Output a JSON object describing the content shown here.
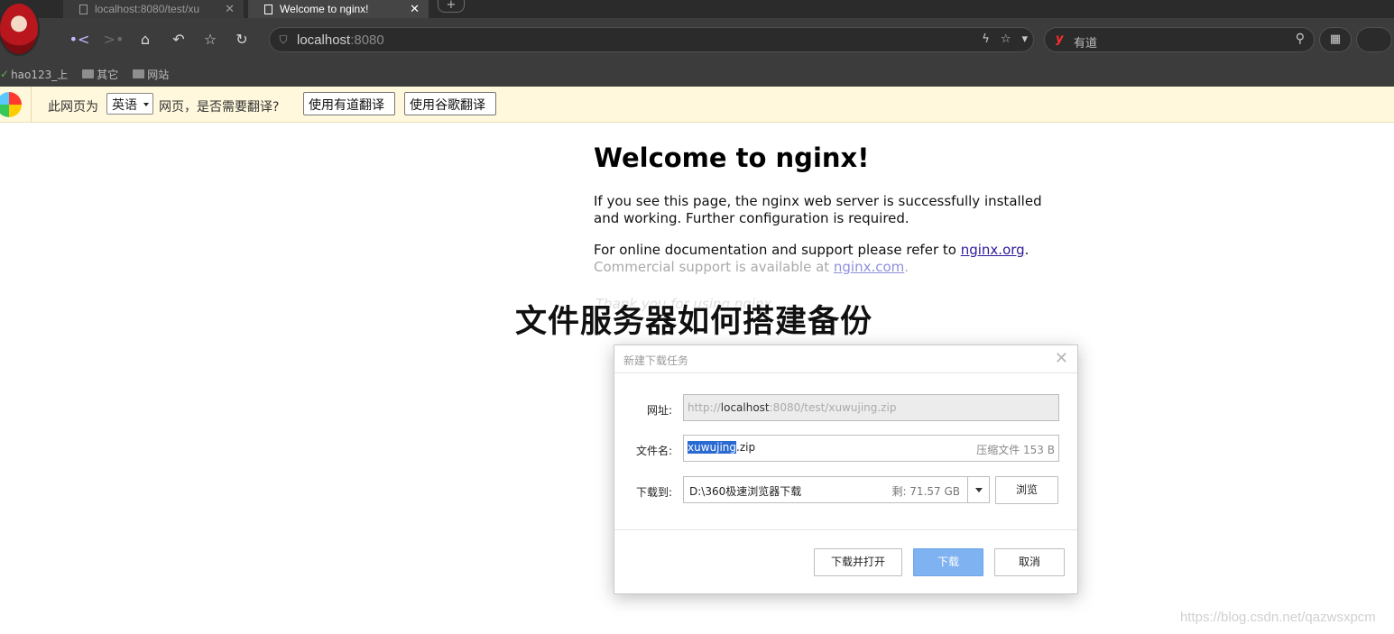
{
  "browser": {
    "tabs": [
      {
        "title": "localhost:8080/test/xu",
        "active": false
      },
      {
        "title": "Welcome to nginx!",
        "active": true
      }
    ],
    "new_tab_label": "+",
    "address": {
      "host": "localhost",
      "port": ":8080"
    },
    "search": {
      "engine_label": "有道",
      "icon_letter": "y"
    },
    "bookmarks": [
      {
        "label": "hao123_上"
      },
      {
        "label": "其它"
      },
      {
        "label": "网站"
      }
    ]
  },
  "translate_bar": {
    "prefix": "此网页为",
    "language": "英语",
    "suffix": "网页，是否需要翻译?",
    "youdao_button": "使用有道翻译",
    "google_button": "使用谷歌翻译"
  },
  "page": {
    "heading": "Welcome to nginx!",
    "para1": "If you see this page, the nginx web server is successfully installed and working. Further configuration is required.",
    "para2_prefix": "For online documentation and support please refer to ",
    "para2_link": "nginx.org",
    "para2_suffix": ".",
    "para3_prefix": "Commercial support is available at ",
    "para3_link": "nginx.com",
    "para3_suffix": ".",
    "thanks": "Thank you for using nginx."
  },
  "overlay_title": "文件服务器如何搭建备份",
  "download_dialog": {
    "title": "新建下载任务",
    "url_label": "网址:",
    "url_prefix": "http://",
    "url_host": "localhost",
    "url_rest": ":8080/test/xuwujing.zip",
    "filename_label": "文件名:",
    "filename_selected": "xuwujing",
    "filename_ext": ".zip",
    "file_info": "压缩文件 153 B",
    "dest_label": "下载到:",
    "dest_path": "D:\\360极速浏览器下载",
    "free_space": "剩: 71.57 GB",
    "browse_button": "浏览",
    "open_button": "下载并打开",
    "download_button": "下载",
    "cancel_button": "取消"
  },
  "watermark": "https://blog.csdn.net/qazwsxpcm",
  "colors": {
    "chrome_dark": "#3c3c3c",
    "translate_bar_bg": "#fff8dc",
    "download_primary": "#7fb2f0",
    "selection": "#2a6ad1"
  }
}
